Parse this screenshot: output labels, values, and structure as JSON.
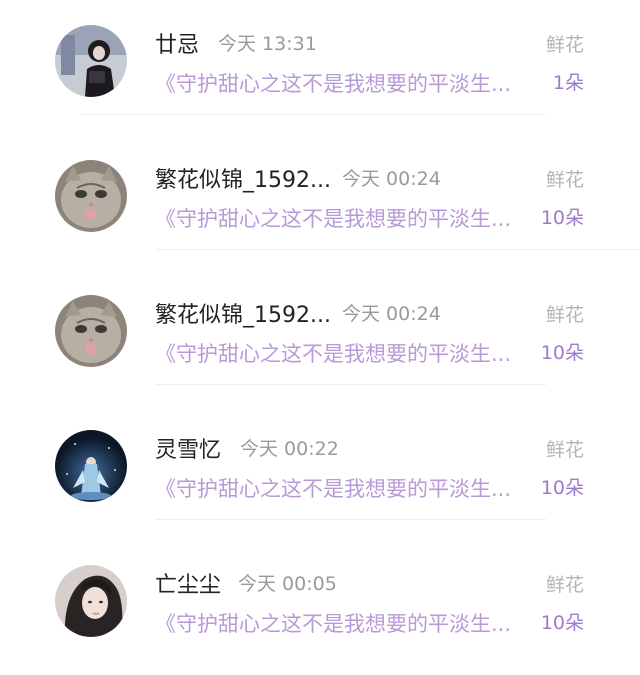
{
  "records": [
    {
      "name": "廿忌",
      "time": "今天 13:31",
      "gift_label": "鲜花",
      "book_title": "《守护甜心之这不是我想要的平淡生...",
      "gift_count": "1朵",
      "avatar_icon": "avatar-girl-dark-photo"
    },
    {
      "name": "繁花似锦_1592...",
      "time": "今天 00:24",
      "gift_label": "鲜花",
      "book_title": "《守护甜心之这不是我想要的平淡生...",
      "gift_count": "10朵",
      "avatar_icon": "avatar-cat-photo"
    },
    {
      "name": "繁花似锦_1592...",
      "time": "今天 00:24",
      "gift_label": "鲜花",
      "book_title": "《守护甜心之这不是我想要的平淡生...",
      "gift_count": "10朵",
      "avatar_icon": "avatar-cat-photo"
    },
    {
      "name": "灵雪忆",
      "time": "今天 00:22",
      "gift_label": "鲜花",
      "book_title": "《守护甜心之这不是我想要的平淡生...",
      "gift_count": "10朵",
      "avatar_icon": "avatar-night-figure-illustration"
    },
    {
      "name": "亡尘尘",
      "time": "今天 00:05",
      "gift_label": "鲜花",
      "book_title": "《守护甜心之这不是我想要的平淡生...",
      "gift_count": "10朵",
      "avatar_icon": "avatar-portrait-photo"
    }
  ],
  "colors": {
    "book_title": "#b89ad6",
    "gift_count": "#9c7bc9",
    "gift_label": "#b5b5b5",
    "time": "#9a9a9a",
    "name": "#222222"
  }
}
